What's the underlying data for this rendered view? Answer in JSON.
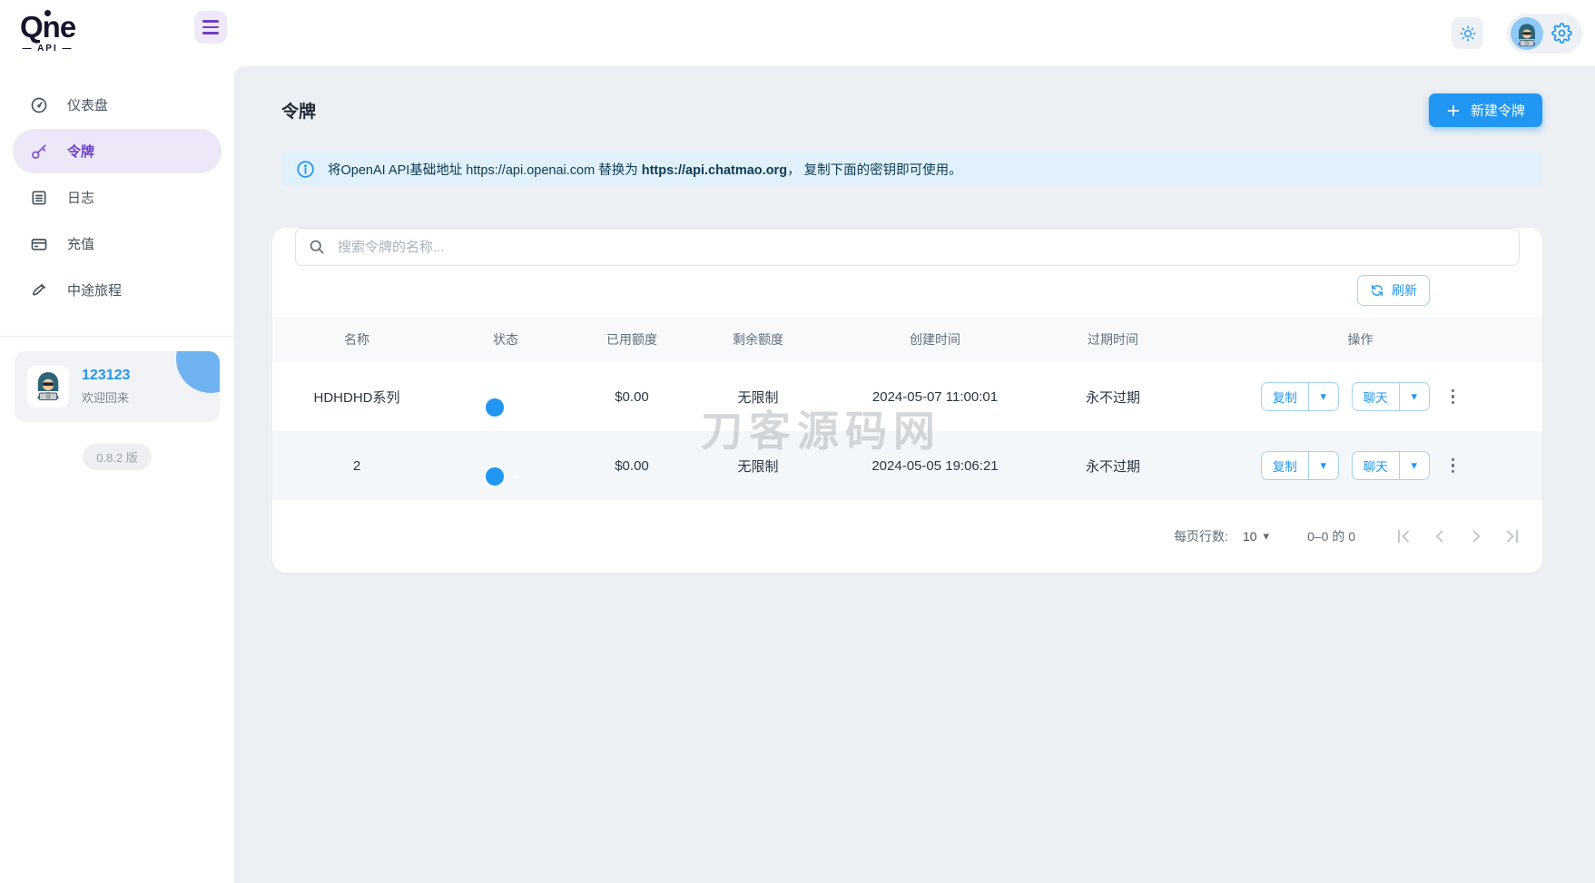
{
  "brand": {
    "name": "Qne",
    "sub": "— API —"
  },
  "sidebar": {
    "items": [
      {
        "label": "仪表盘",
        "icon": "dashboard-icon",
        "active": false
      },
      {
        "label": "令牌",
        "icon": "key-icon",
        "active": true
      },
      {
        "label": "日志",
        "icon": "logs-icon",
        "active": false
      },
      {
        "label": "充值",
        "icon": "recharge-icon",
        "active": false
      },
      {
        "label": "中途旅程",
        "icon": "brush-icon",
        "active": false
      }
    ],
    "user": {
      "name": "123123",
      "greeting": "欢迎回来"
    },
    "version": "0.8.2 版"
  },
  "page": {
    "title": "令牌",
    "new_token_button": "新建令牌",
    "notice": {
      "prefix": "将OpenAI API基础地址 https://api.openai.com 替换为 ",
      "bold": "https://api.chatmao.org",
      "suffix": "， 复制下面的密钥即可使用。"
    },
    "search_placeholder": "搜索令牌的名称...",
    "refresh_button": "刷新"
  },
  "table": {
    "headers": [
      "名称",
      "状态",
      "已用额度",
      "剩余额度",
      "创建时间",
      "过期时间",
      "操作"
    ],
    "rows": [
      {
        "name": "HDHDHD系列",
        "status_on": true,
        "used": "$0.00",
        "remaining": "无限制",
        "created": "2024-05-07 11:00:01",
        "expires": "永不过期"
      },
      {
        "name": "2",
        "status_on": true,
        "used": "$0.00",
        "remaining": "无限制",
        "created": "2024-05-05 19:06:21",
        "expires": "永不过期"
      }
    ],
    "row_actions": {
      "copy": "复制",
      "chat": "聊天"
    }
  },
  "pagination": {
    "rows_per_page_label": "每页行数:",
    "rows_per_page": "10",
    "range": "0–0 的 0"
  },
  "watermark": "刀客源码网",
  "colors": {
    "primary_blue": "#2196F3",
    "active_purple": "#6B3FC9",
    "active_purple_bg": "#EDE7F7",
    "notice_bg": "#E1F1FB",
    "content_bg": "#ECEFF3",
    "toggle_track": "#8EC9F8",
    "watermark_gray": "#A0A8B0"
  }
}
